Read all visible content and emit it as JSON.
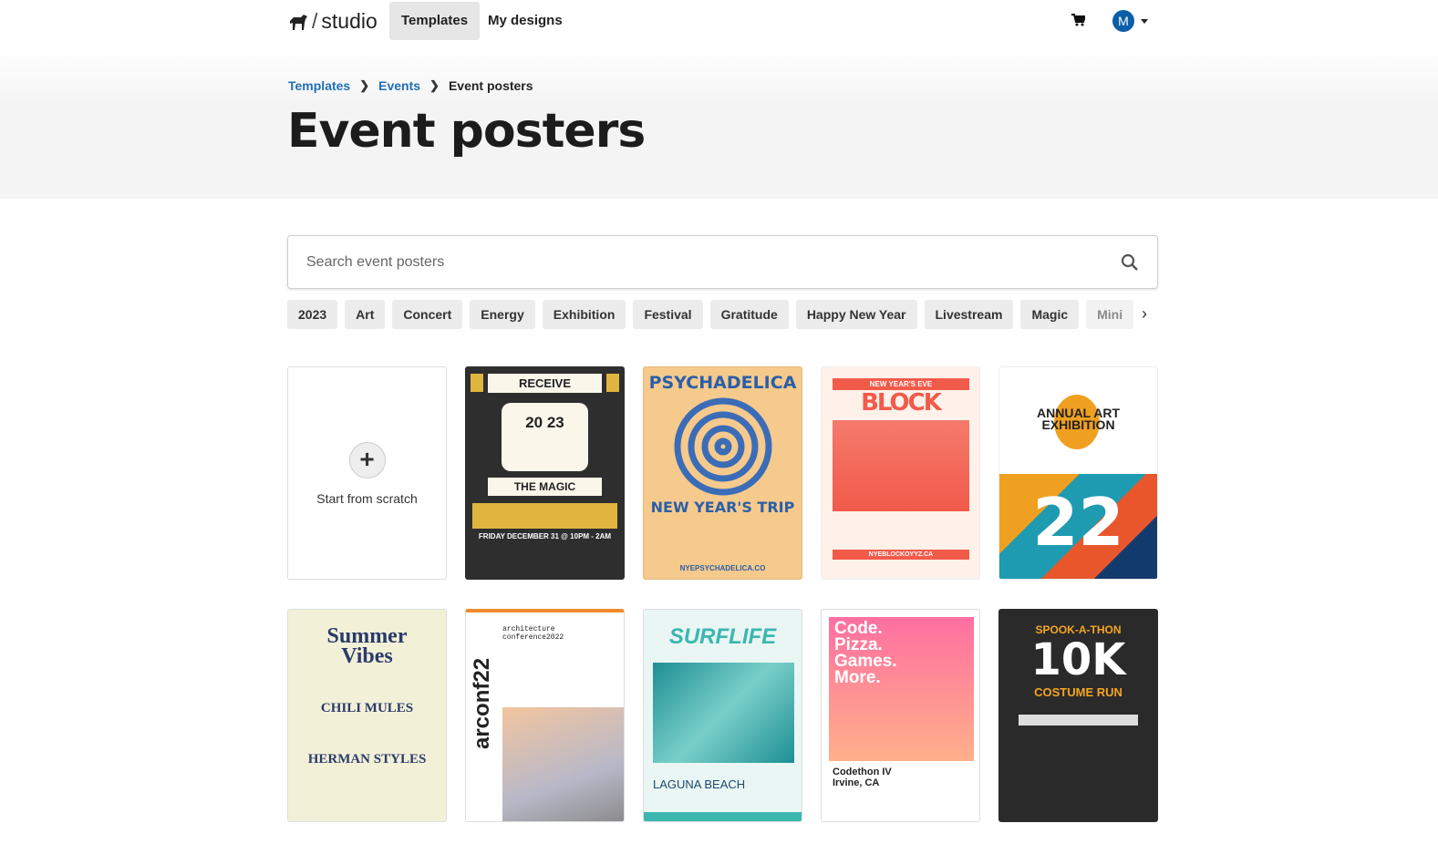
{
  "nav": {
    "brand": "studio",
    "tabs": [
      {
        "label": "Templates",
        "active": true
      },
      {
        "label": "My designs",
        "active": false
      }
    ],
    "cart_icon": "cart-icon",
    "avatar_initial": "M",
    "avatar_color": "#0b5ea8"
  },
  "breadcrumb": [
    "Templates",
    "Events",
    "Event posters"
  ],
  "page_title": "Event posters",
  "search": {
    "placeholder": "Search event posters",
    "value": ""
  },
  "chips": [
    "2023",
    "Art",
    "Concert",
    "Energy",
    "Exhibition",
    "Festival",
    "Gratitude",
    "Happy New Year",
    "Livestream",
    "Magic",
    "Mini"
  ],
  "scratch_label": "Start from scratch",
  "posters": [
    {
      "title": "RECEIVE",
      "sub": "THE MAGIC",
      "year": "20 23",
      "line": "FRIDAY DECEMBER 31 @ 10PM - 2AM",
      "bg": "#2e2e2e"
    },
    {
      "title": "PSYCHADELICA",
      "sub": "NEW YEAR'S TRIP",
      "line": "NYEPSYCHADELICA.CO",
      "bg": "#f6c98c"
    },
    {
      "title": "NEW YEAR'S EVE",
      "sub": "BLOCK PARTY",
      "line": "NYEBLOCKOYYZ.CA",
      "bg": "#f25a4a"
    },
    {
      "title": "ANNUAL ART EXHIBITION",
      "sub": "22",
      "bg": "#fff"
    },
    {
      "title": "Summer Vibes",
      "sub": "CHILI MULES",
      "line": "HERMAN STYLES",
      "bg": "#f3f0d8"
    },
    {
      "title": "arconf22",
      "sub": "architecture conference2022",
      "bg": "#fff"
    },
    {
      "title": "SURFLIFE",
      "sub": "LAGUNA BEACH",
      "bg": "#e9f6f4"
    },
    {
      "title": "Code. Pizza. Games. More.",
      "sub": "Codethon IV Irvine, CA",
      "bg": "#ff9b8a"
    },
    {
      "title": "SPOOK-A-THON",
      "sub": "10K",
      "line": "COSTUME RUN",
      "bg": "#2a2a2a"
    }
  ]
}
